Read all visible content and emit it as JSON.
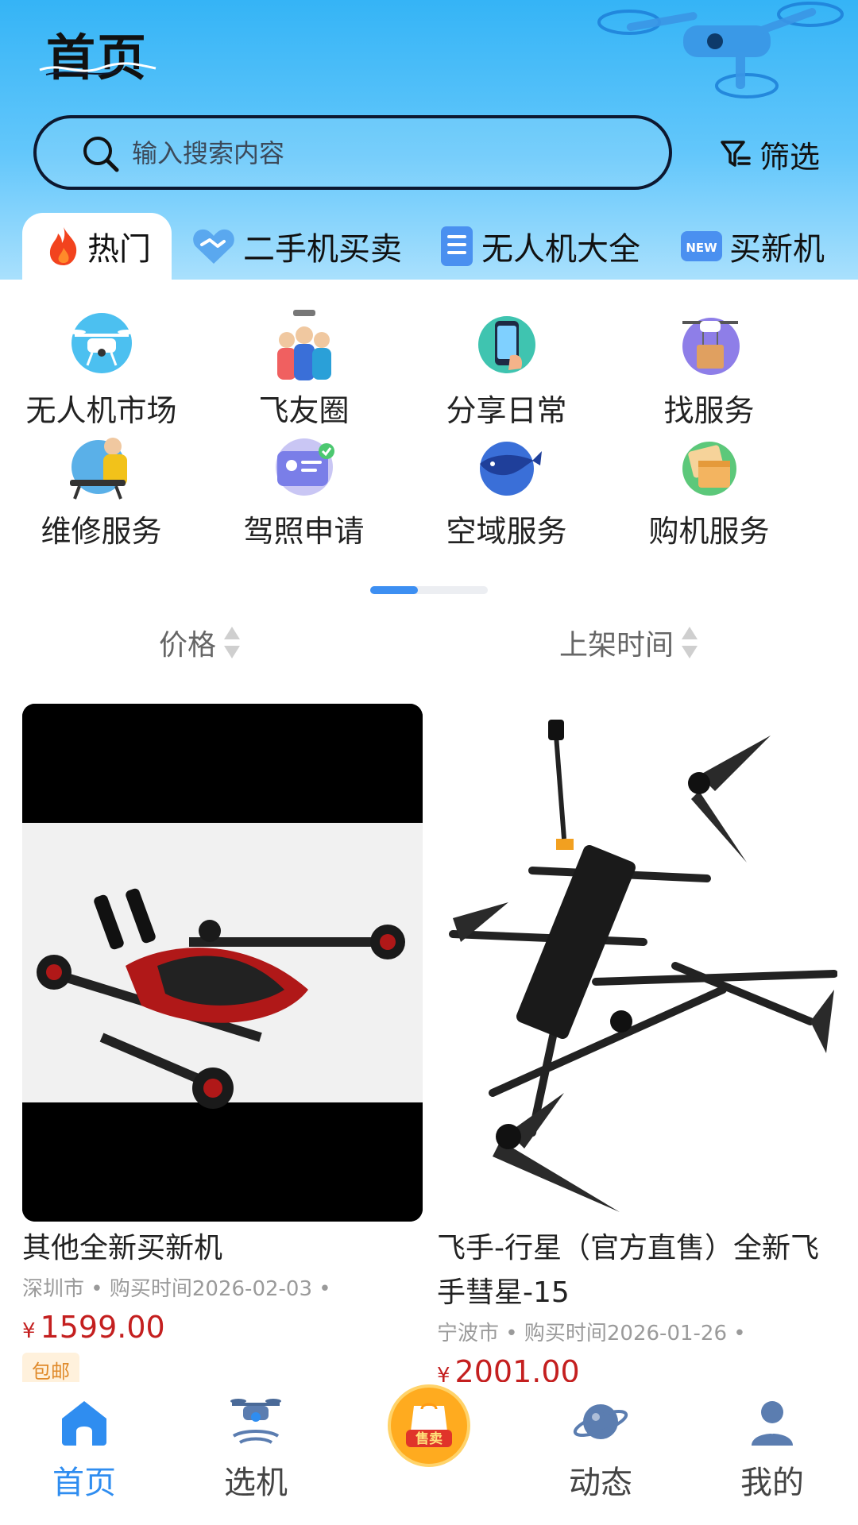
{
  "header": {
    "title": "首页",
    "search_placeholder": "输入搜索内容",
    "filter_label": "筛选"
  },
  "tabs": [
    {
      "label": "热门",
      "icon": "flame-icon",
      "active": true
    },
    {
      "label": "二手机买卖",
      "icon": "handshake-icon",
      "active": false
    },
    {
      "label": "无人机大全",
      "icon": "catalog-icon",
      "active": false
    },
    {
      "label": "买新机",
      "icon": "new-badge-icon",
      "active": false
    }
  ],
  "new_badge_text": "NEW",
  "categories": [
    {
      "label": "无人机市场",
      "icon": "drone-market-icon"
    },
    {
      "label": "飞友圈",
      "icon": "flyer-friends-icon"
    },
    {
      "label": "分享日常",
      "icon": "phone-share-icon"
    },
    {
      "label": "找服务",
      "icon": "delivery-drone-icon"
    },
    {
      "label": "维修服务",
      "icon": "repair-service-icon"
    },
    {
      "label": "驾照申请",
      "icon": "license-card-icon"
    },
    {
      "label": "空域服务",
      "icon": "airspace-whale-icon"
    },
    {
      "label": "购机服务",
      "icon": "purchase-box-icon"
    }
  ],
  "pager": {
    "current_page": 1,
    "total_pages": 2
  },
  "sort": {
    "price_label": "价格",
    "listing_time_label": "上架时间"
  },
  "products": [
    {
      "title": "其他全新买新机",
      "city": "深圳市",
      "purchase_time": "购买时间2026-02-03",
      "currency": "¥",
      "price": "1599.00",
      "badge": "包邮",
      "image": "red-fpv-drone-photo"
    },
    {
      "title": "飞手-行星（官方直售）全新飞手彗星-15",
      "city": "宁波市",
      "purchase_time": "购买时间2026-01-26",
      "currency": "¥",
      "price": "2001.00",
      "image": "black-long-range-fpv-drone-photo"
    }
  ],
  "meta_separator": "•",
  "bottom_nav": [
    {
      "label": "首页",
      "icon": "home-icon",
      "active": true
    },
    {
      "label": "选机",
      "icon": "drone-select-icon",
      "active": false
    },
    {
      "label": "售卖",
      "icon": "sell-bag-icon",
      "active": false
    },
    {
      "label": "动态",
      "icon": "planet-icon",
      "active": false
    },
    {
      "label": "我的",
      "icon": "profile-icon",
      "active": false
    }
  ],
  "colors": {
    "header_blue": "#35b4f6",
    "accent_blue": "#2f8df0",
    "price_red": "#c41f1f",
    "sell_orange": "#ff9b12"
  }
}
